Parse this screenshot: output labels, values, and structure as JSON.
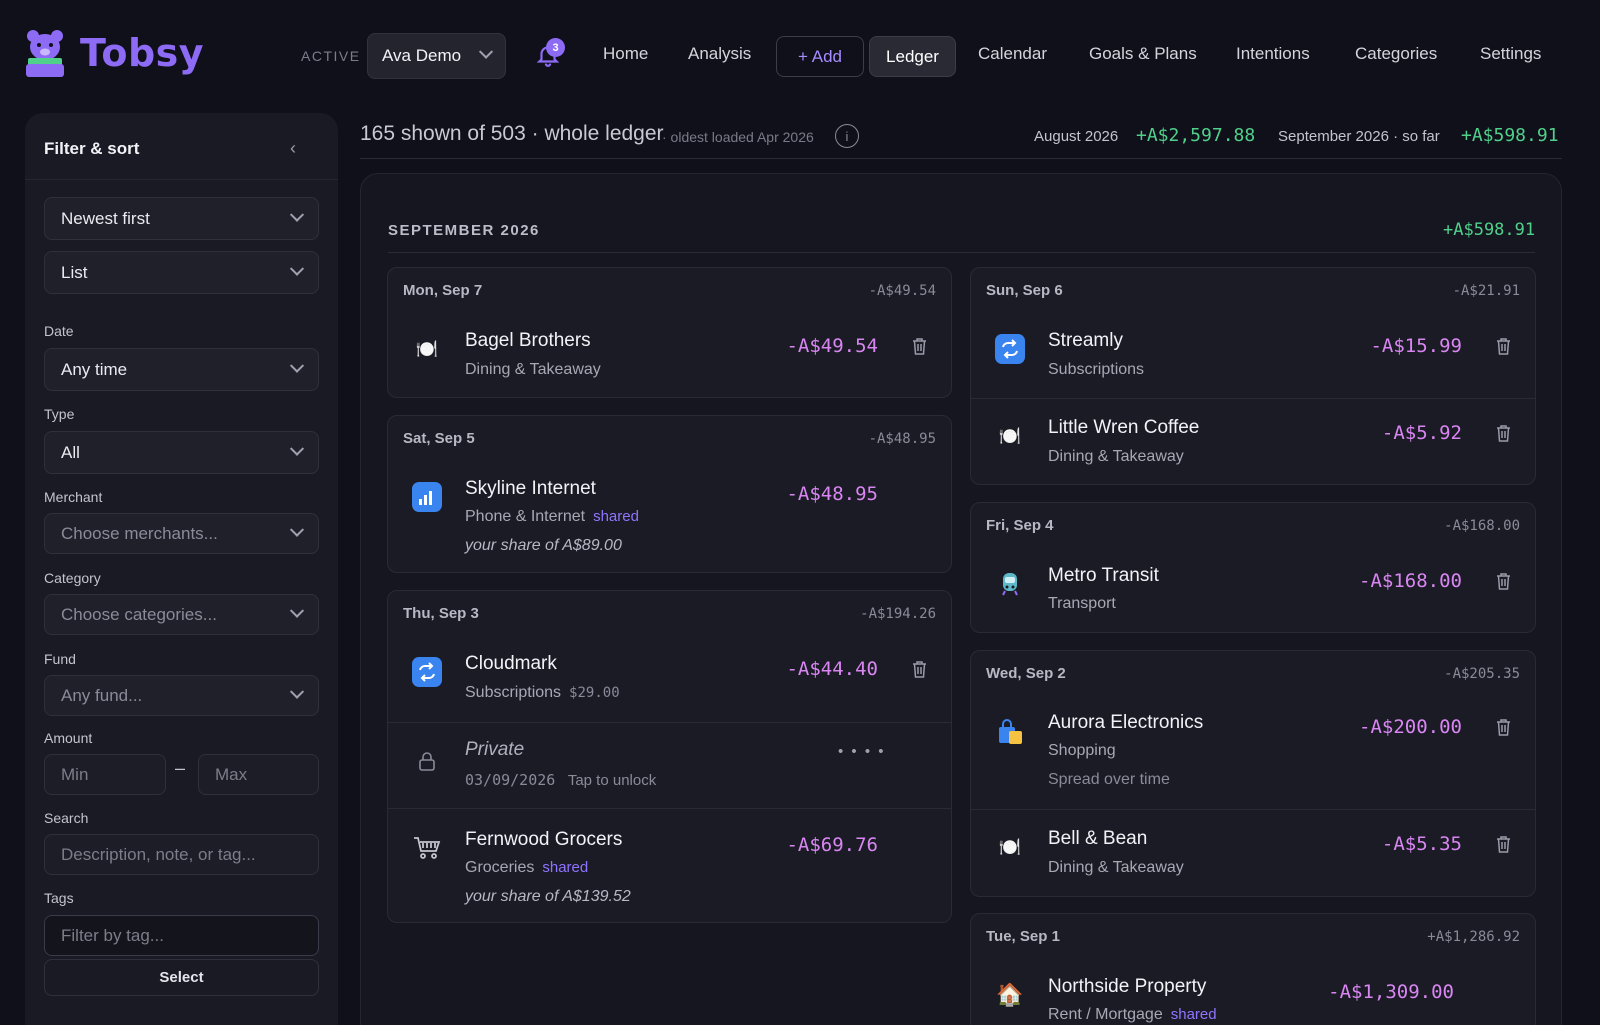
{
  "app": {
    "name": "Tobsy"
  },
  "header": {
    "active_label": "ACTIVE",
    "profile": "Ava Demo",
    "notifications": "3",
    "nav": {
      "home": "Home",
      "analysis": "Analysis",
      "add": "+ Add",
      "ledger": "Ledger",
      "calendar": "Calendar",
      "goals": "Goals & Plans",
      "intentions": "Intentions",
      "categories": "Categories",
      "settings": "Settings"
    }
  },
  "sidebar": {
    "title": "Filter & sort",
    "sort": "Newest first",
    "view": "List",
    "date_label": "Date",
    "date_value": "Any time",
    "type_label": "Type",
    "type_value": "All",
    "merchant_label": "Merchant",
    "merchant_placeholder": "Choose merchants...",
    "category_label": "Category",
    "category_placeholder": "Choose categories...",
    "fund_label": "Fund",
    "fund_placeholder": "Any fund...",
    "amount_label": "Amount",
    "min_placeholder": "Min",
    "max_placeholder": "Max",
    "amount_dash": "–",
    "search_label": "Search",
    "search_placeholder": "Description, note, or tag...",
    "tags_label": "Tags",
    "tags_placeholder": "Filter by tag...",
    "select_button": "Select"
  },
  "summary": {
    "count_text": "165 shown of 503 · whole ledger",
    "oldest": "· oldest loaded Apr 2026",
    "info": "i",
    "month1_label": "August 2026",
    "month1_value": "+A$2,597.88",
    "month2_label": "September 2026 · so far",
    "month2_value": "+A$598.91"
  },
  "month": {
    "title": "SEPTEMBER 2026",
    "total": "+A$598.91"
  },
  "colors": {
    "accent": "#8d6bf5",
    "positive": "#4fd18b",
    "negative": "#d986f2",
    "shared": "#8f74ff"
  },
  "days_left": [
    {
      "date": "Mon, Sep 7",
      "total": "-A$49.54",
      "tx": [
        {
          "icon": "plate-icon",
          "name": "Bagel Brothers",
          "category": "Dining & Takeaway",
          "amount": "-A$49.54"
        }
      ]
    },
    {
      "date": "Sat, Sep 5",
      "total": "-A$48.95",
      "tx": [
        {
          "icon": "signal-icon",
          "name": "Skyline Internet",
          "category": "Phone & Internet",
          "shared": "shared",
          "note": "your share of A$89.00",
          "amount": "-A$48.95"
        }
      ]
    },
    {
      "date": "Thu, Sep 3",
      "total": "-A$194.26",
      "tx": [
        {
          "icon": "repeat-icon",
          "name": "Cloudmark",
          "category": "Subscriptions",
          "extra": "$29.00",
          "amount": "-A$44.40"
        },
        {
          "icon": "lock-icon",
          "name": "Private",
          "sub": "03/09/2026",
          "unlock": "Tap to unlock",
          "masked": "• • • •"
        },
        {
          "icon": "cart-icon",
          "name": "Fernwood Grocers",
          "category": "Groceries",
          "shared": "shared",
          "note": "your share of A$139.52",
          "amount": "-A$69.76"
        }
      ]
    }
  ],
  "days_right": [
    {
      "date": "Sun, Sep 6",
      "total": "-A$21.91",
      "tx": [
        {
          "icon": "repeat-icon",
          "name": "Streamly",
          "category": "Subscriptions",
          "amount": "-A$15.99"
        },
        {
          "icon": "plate-icon",
          "name": "Little Wren Coffee",
          "category": "Dining & Takeaway",
          "amount": "-A$5.92"
        }
      ]
    },
    {
      "date": "Fri, Sep 4",
      "total": "-A$168.00",
      "tx": [
        {
          "icon": "transit-icon",
          "name": "Metro Transit",
          "category": "Transport",
          "amount": "-A$168.00"
        }
      ]
    },
    {
      "date": "Wed, Sep 2",
      "total": "-A$205.35",
      "tx": [
        {
          "icon": "shopping-bag-icon",
          "name": "Aurora Electronics",
          "category": "Shopping",
          "sub": "Spread over time",
          "amount": "-A$200.00"
        },
        {
          "icon": "plate-icon",
          "name": "Bell & Bean",
          "category": "Dining & Takeaway",
          "amount": "-A$5.35"
        }
      ]
    },
    {
      "date": "Tue, Sep 1",
      "total": "+A$1,286.92",
      "tx": [
        {
          "icon": "house-icon",
          "name": "Northside Property",
          "category": "Rent / Mortgage",
          "shared": "shared",
          "amount": "-A$1,309.00"
        }
      ]
    }
  ]
}
